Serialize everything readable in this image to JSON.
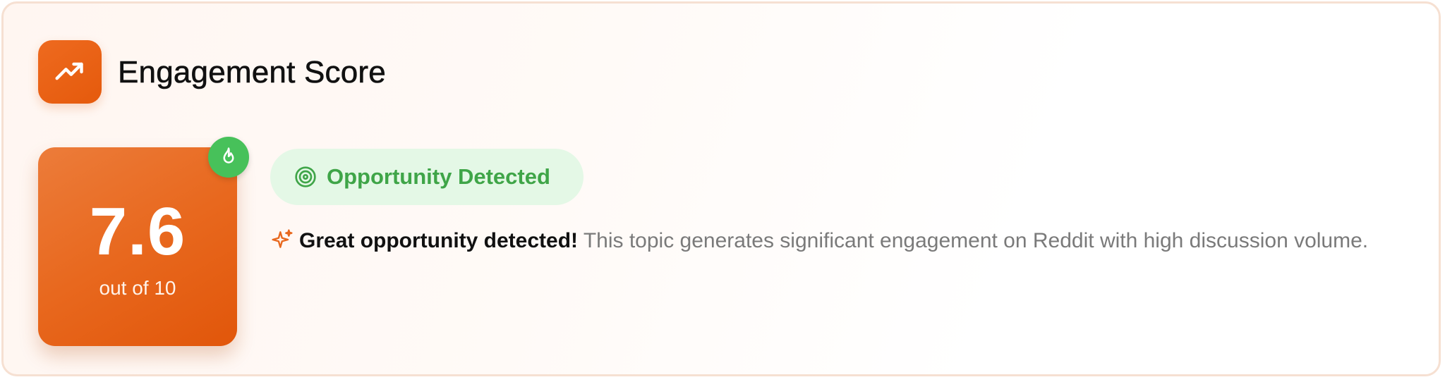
{
  "header": {
    "title": "Engagement Score",
    "icon": "trending-up-icon"
  },
  "score": {
    "value": "7.6",
    "subtitle": "out of 10",
    "badge_icon": "flame-icon"
  },
  "status": {
    "label": "Opportunity Detected",
    "icon": "target-icon"
  },
  "description": {
    "icon": "sparkles-icon",
    "bold": "Great opportunity detected!",
    "text": "This topic generates significant engagement on Reddit with high discussion volume."
  },
  "colors": {
    "accent": "#e8681e",
    "success": "#47c15a",
    "success_text": "#3fa548",
    "success_bg": "#e4f8e6"
  }
}
